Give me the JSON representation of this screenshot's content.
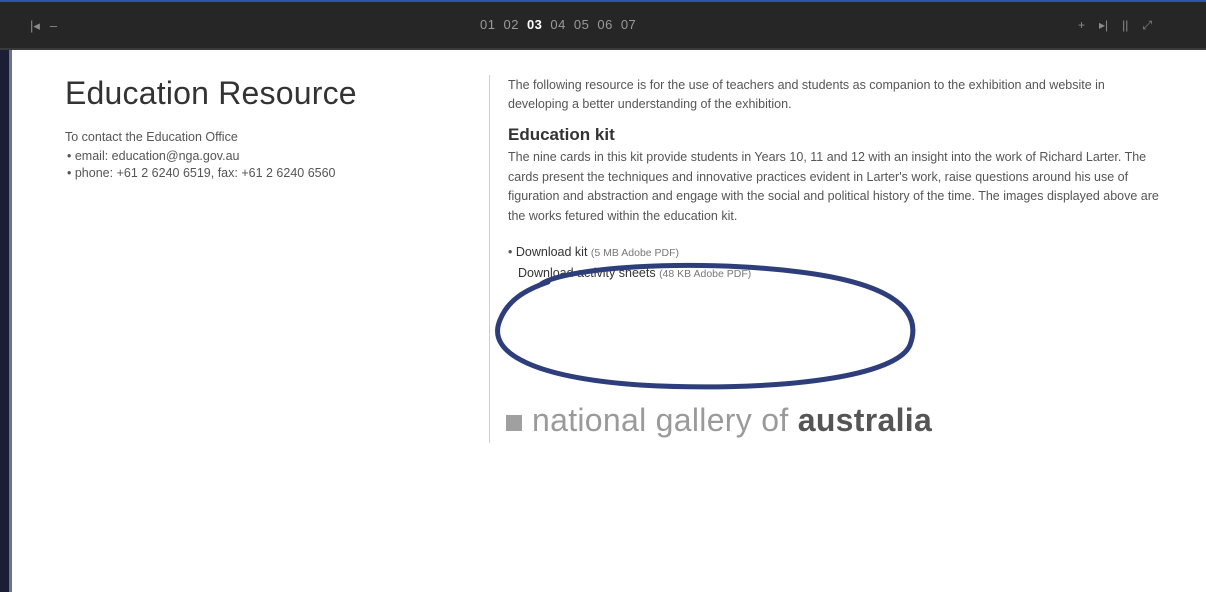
{
  "topbar": {
    "left_controls": [
      "|◂",
      "–"
    ],
    "pages": [
      "01",
      "02",
      "03",
      "04",
      "05",
      "06",
      "07"
    ],
    "active_page": "03",
    "right_controls": [
      "+",
      "▸|",
      "||",
      "⤢"
    ]
  },
  "left": {
    "title": "Education Resource",
    "contact_label": "To contact the Education Office",
    "email": "email: education@nga.gov.au",
    "phone": "phone: +61 2 6240 6519, fax: +61 2 6240 6560"
  },
  "right": {
    "intro": "The following resource is for the use of teachers and students as companion to the exhibition and website in developing a better understanding of the exhibition.",
    "kit_heading": "Education kit",
    "kit_text": "The nine cards in this kit provide students in Years 10, 11 and 12 with an insight into the work of Richard Larter. The cards present the techniques and innovative practices evident in Larter's work, raise questions around his use of figuration and abstraction and engage with the social and political history of the time. The images displayed above are the works fetured within the education kit.",
    "downloads": [
      {
        "label": "Download kit",
        "meta": "(5 MB Adobe PDF)"
      },
      {
        "label": "Download activity sheets",
        "meta": "(48 KB Adobe PDF)"
      }
    ]
  },
  "logo": {
    "light": "national gallery of ",
    "bold": "australia"
  },
  "colors": {
    "topbar_bg": "#262626",
    "annotation_ellipse": "#2e3e7a",
    "frame": "#1b1f36"
  }
}
